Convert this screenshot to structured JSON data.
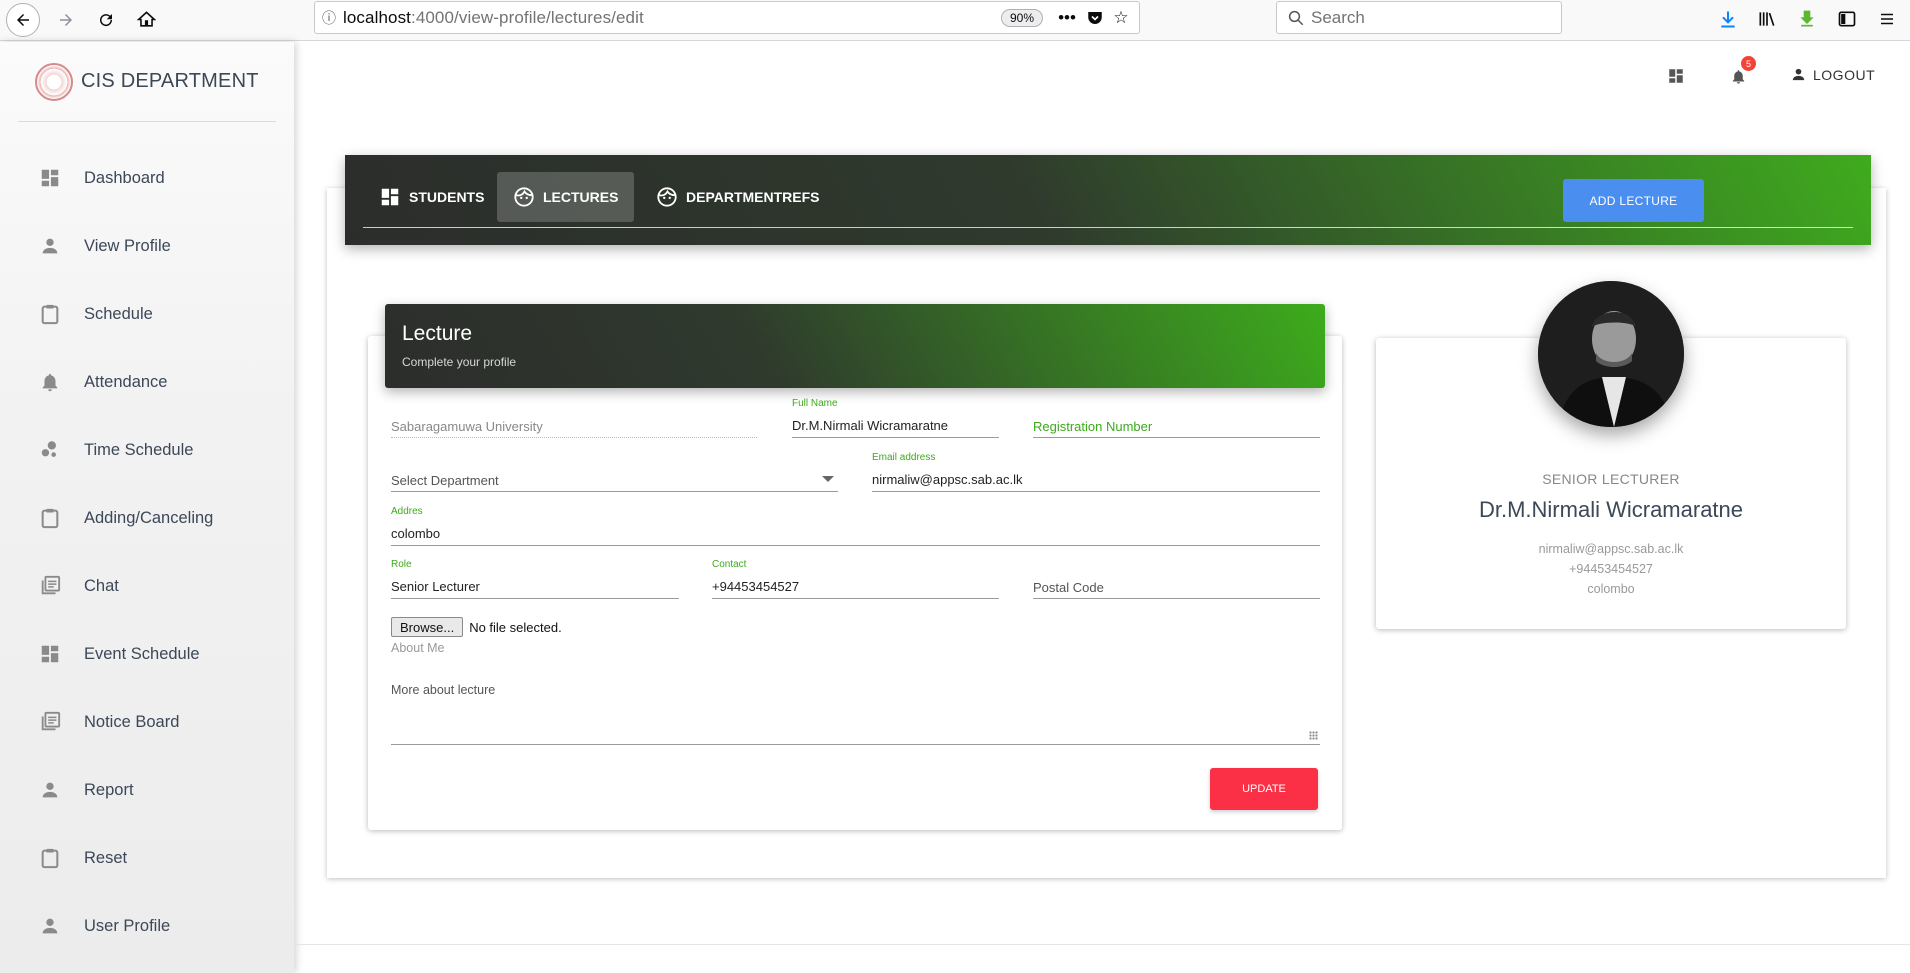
{
  "browser": {
    "url_host": "localhost",
    "url_path": ":4000/view-profile/lectures/edit",
    "zoom": "90%",
    "search_placeholder": "Search"
  },
  "sidebar": {
    "brand": "CIS DEPARTMENT",
    "items": [
      {
        "label": "Dashboard",
        "icon": "dashboard-icon"
      },
      {
        "label": "View Profile",
        "icon": "person-icon"
      },
      {
        "label": "Schedule",
        "icon": "clipboard-icon"
      },
      {
        "label": "Attendance",
        "icon": "bell-icon"
      },
      {
        "label": "Time Schedule",
        "icon": "bubble-chart-icon"
      },
      {
        "label": "Adding/Canceling",
        "icon": "clipboard-icon"
      },
      {
        "label": "Chat",
        "icon": "library-books-icon"
      },
      {
        "label": "Event Schedule",
        "icon": "dashboard-icon"
      },
      {
        "label": "Notice Board",
        "icon": "library-books-icon"
      },
      {
        "label": "Report",
        "icon": "person-icon"
      },
      {
        "label": "Reset",
        "icon": "clipboard-icon"
      },
      {
        "label": "User Profile",
        "icon": "person-icon"
      }
    ]
  },
  "topbar": {
    "notification_count": "5",
    "logout_label": "LOGOUT"
  },
  "tabs": {
    "items": [
      {
        "label": "STUDENTS"
      },
      {
        "label": "LECTURES"
      },
      {
        "label": "DEPARTMENTREFS"
      }
    ],
    "active": "LECTURES",
    "add_button": "ADD LECTURE"
  },
  "form": {
    "title": "Lecture",
    "subtitle": "Complete your profile",
    "university": "Sabaragamuwa University",
    "full_name_label": "Full Name",
    "full_name": "Dr.M.Nirmali Wicramaratne",
    "registration_placeholder": "Registration Number",
    "department_placeholder": "Select Department",
    "email_label": "Email address",
    "email": "nirmaliw@appsc.sab.ac.lk",
    "address_label": "Addres",
    "address": "colombo",
    "role_label": "Role",
    "role": "Senior Lecturer",
    "contact_label": "Contact",
    "contact": "+94453454527",
    "postal_placeholder": "Postal Code",
    "browse_label": "Browse...",
    "no_file": "No file selected.",
    "about_label": "About Me",
    "more_placeholder": "More about lecture",
    "update_button": "UPDATE"
  },
  "profile": {
    "role": "SENIOR LECTURER",
    "name": "Dr.M.Nirmali Wicramaratne",
    "email": "nirmaliw@appsc.sab.ac.lk",
    "phone": "+94453454527",
    "city": "colombo"
  },
  "colors": {
    "header_gradient_start": "#2b2d2b",
    "header_gradient_end": "#3fab1e",
    "add_button": "#4a8ef0",
    "update_button": "#fb2f45",
    "label_green": "#3daa1d"
  }
}
